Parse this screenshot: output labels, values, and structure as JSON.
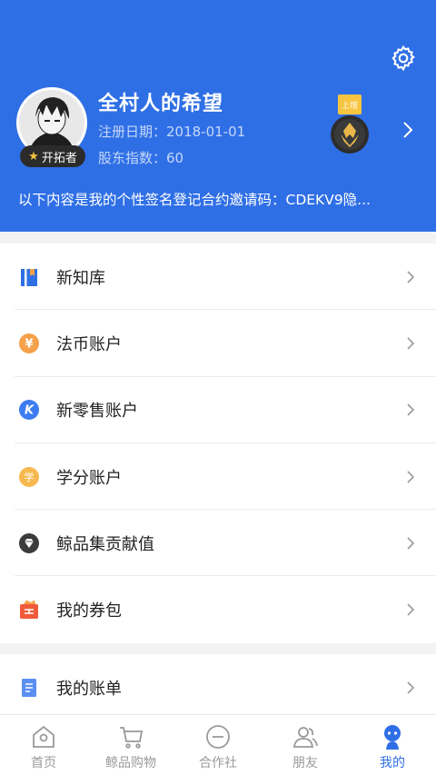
{
  "profile": {
    "username": "全村人的希望",
    "badge": "开拓者",
    "registration": "注册日期：2018-01-01",
    "share_index": "股东指数：60",
    "medal_text": "上增",
    "signature": "以下内容是我的个性签名登记合约邀请码：CDEKV9隐..."
  },
  "menu": [
    {
      "label": "新知库",
      "icon": "book-icon"
    },
    {
      "label": "法币账户",
      "icon": "yen-coin-icon"
    },
    {
      "label": "新零售账户",
      "icon": "k-coin-icon"
    },
    {
      "label": "学分账户",
      "icon": "xue-coin-icon"
    },
    {
      "label": "鲸品集贡献值",
      "icon": "gem-icon"
    },
    {
      "label": "我的券包",
      "icon": "coupon-icon"
    }
  ],
  "menu2": [
    {
      "label": "我的账单",
      "icon": "bill-icon"
    }
  ],
  "tabs": [
    {
      "label": "首页",
      "icon": "home-icon",
      "active": false
    },
    {
      "label": "鲸品购物",
      "icon": "cart-icon",
      "active": false
    },
    {
      "label": "合作社",
      "icon": "cooperative-icon",
      "active": false
    },
    {
      "label": "朋友",
      "icon": "friends-icon",
      "active": false
    },
    {
      "label": "我的",
      "icon": "mine-icon",
      "active": true
    }
  ],
  "colors": {
    "primary": "#2f6fe6",
    "orange": "#f5a14a",
    "red": "#f05a3a"
  }
}
